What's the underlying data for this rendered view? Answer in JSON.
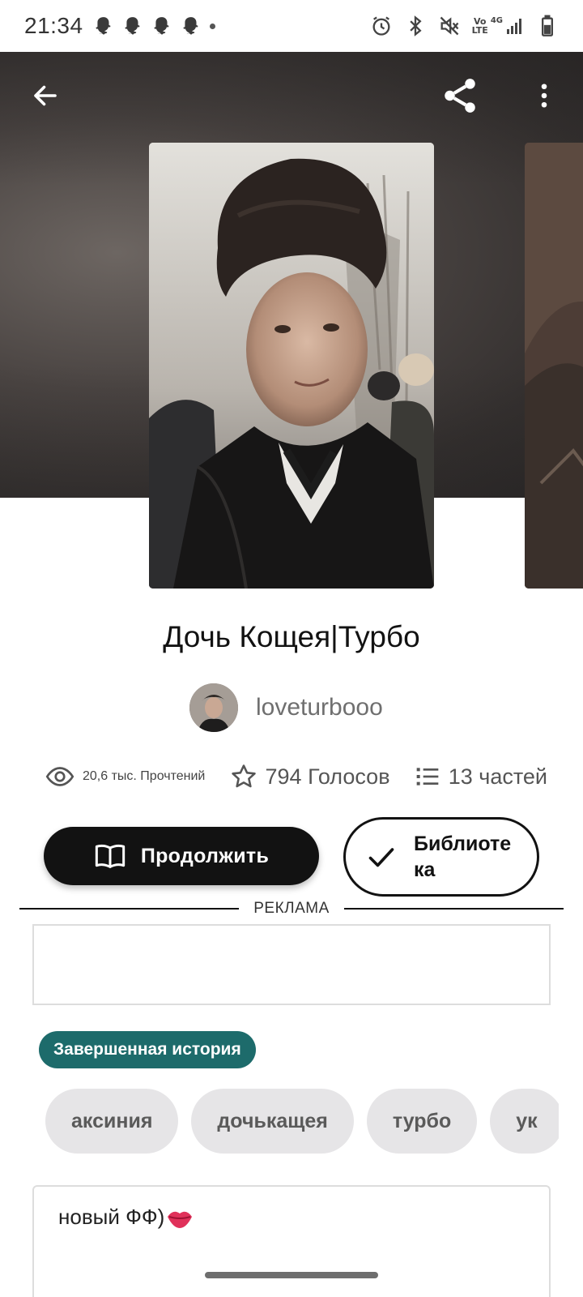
{
  "status_bar": {
    "time": "21:34",
    "notification_icons": [
      "snapchat-icon",
      "snapchat-icon",
      "snapchat-icon",
      "snapchat-icon"
    ],
    "system_icons": [
      "alarm-icon",
      "bluetooth-icon",
      "mute-icon",
      "volte-icon",
      "signal-icon",
      "battery-icon"
    ],
    "volte_top": "Vo",
    "volte_bottom": "LTE",
    "network": "4G"
  },
  "toolbar": {
    "back_icon": "arrow-left-icon",
    "share_icon": "share-icon",
    "more_icon": "more-vertical-icon"
  },
  "story": {
    "title": "Дочь Кощея|Турбо",
    "author": "loveturbooo",
    "reads": "20,6 тыс. Прочтений",
    "votes": "794 Голосов",
    "parts": "13 частей"
  },
  "actions": {
    "continue_label": "Продолжить",
    "library_label": "Библиоте ка"
  },
  "ad": {
    "label": "РЕКЛАМА"
  },
  "status_badge": "Завершенная история",
  "tags": [
    "аксиния",
    "дочькащея",
    "турбо",
    "ук"
  ],
  "description": {
    "text": "новый ФФ)",
    "emoji": "lips-icon"
  },
  "colors": {
    "badge_bg": "#1d6b6b",
    "primary_button": "#121212",
    "tag_bg": "#e6e5e7"
  }
}
